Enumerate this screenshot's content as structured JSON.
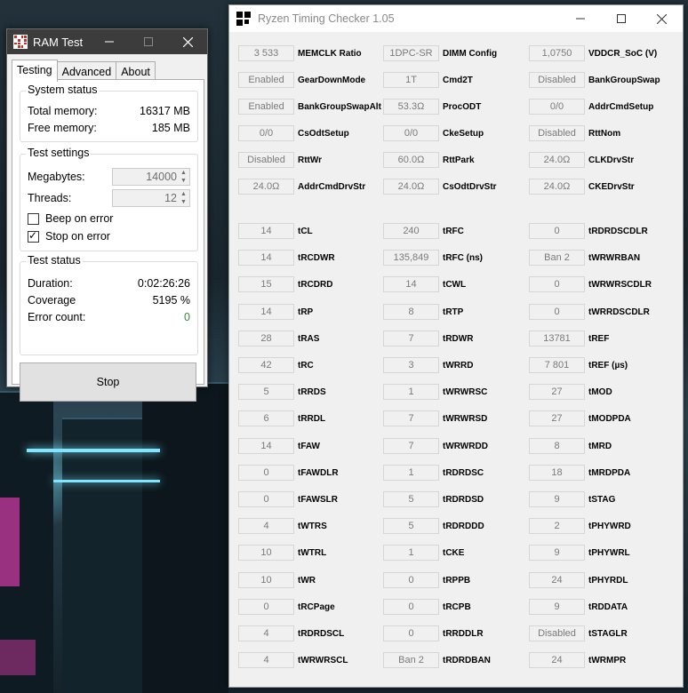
{
  "ram_test": {
    "title": "RAM Test",
    "tabs": [
      "Testing",
      "Advanced",
      "About"
    ],
    "system_status": {
      "heading": "System status",
      "total_label": "Total memory:",
      "total_value": "16317 MB",
      "free_label": "Free memory:",
      "free_value": "185 MB"
    },
    "test_settings": {
      "heading": "Test settings",
      "megabytes_label": "Megabytes:",
      "megabytes_value": "14000",
      "threads_label": "Threads:",
      "threads_value": "12",
      "beep_label": "Beep on error",
      "beep_checked": false,
      "stop_label": "Stop on error",
      "stop_checked": true
    },
    "test_status": {
      "heading": "Test status",
      "duration_label": "Duration:",
      "duration_value": "0:02:26:26",
      "coverage_label": "Coverage",
      "coverage_value": "5195 %",
      "errors_label": "Error count:",
      "errors_value": "0",
      "errors_color": "#3a8a3a"
    },
    "stop_button": "Stop"
  },
  "ryzen": {
    "title": "Ryzen Timing Checker 1.05",
    "top_cols": [
      [
        {
          "value": "3 533",
          "label": "MEMCLK Ratio"
        },
        {
          "value": "Enabled",
          "label": "GearDownMode"
        },
        {
          "value": "Enabled",
          "label": "BankGroupSwapAlt"
        },
        {
          "value": "0/0",
          "label": "CsOdtSetup"
        },
        {
          "value": "Disabled",
          "label": "RttWr"
        },
        {
          "value": "24.0Ω",
          "label": "AddrCmdDrvStr"
        }
      ],
      [
        {
          "value": "1DPC-SR",
          "label": "DIMM Config"
        },
        {
          "value": "1T",
          "label": "Cmd2T"
        },
        {
          "value": "53.3Ω",
          "label": "ProcODT"
        },
        {
          "value": "0/0",
          "label": "CkeSetup"
        },
        {
          "value": "60.0Ω",
          "label": "RttPark"
        },
        {
          "value": "24.0Ω",
          "label": "CsOdtDrvStr"
        }
      ],
      [
        {
          "value": "1,0750",
          "label": "VDDCR_SoC (V)"
        },
        {
          "value": "Disabled",
          "label": "BankGroupSwap"
        },
        {
          "value": "0/0",
          "label": "AddrCmdSetup"
        },
        {
          "value": "Disabled",
          "label": "RttNom"
        },
        {
          "value": "24.0Ω",
          "label": "CLKDrvStr"
        },
        {
          "value": "24.0Ω",
          "label": "CKEDrvStr"
        }
      ]
    ],
    "timing_cols": [
      [
        {
          "value": "14",
          "label": "tCL"
        },
        {
          "value": "14",
          "label": "tRCDWR"
        },
        {
          "value": "15",
          "label": "tRCDRD"
        },
        {
          "value": "14",
          "label": "tRP"
        },
        {
          "value": "28",
          "label": "tRAS"
        },
        {
          "value": "42",
          "label": "tRC"
        },
        {
          "value": "5",
          "label": "tRRDS"
        },
        {
          "value": "6",
          "label": "tRRDL"
        },
        {
          "value": "14",
          "label": "tFAW"
        },
        {
          "value": "0",
          "label": "tFAWDLR"
        },
        {
          "value": "0",
          "label": "tFAWSLR"
        },
        {
          "value": "4",
          "label": "tWTRS"
        },
        {
          "value": "10",
          "label": "tWTRL"
        },
        {
          "value": "10",
          "label": "tWR"
        },
        {
          "value": "0",
          "label": "tRCPage"
        },
        {
          "value": "4",
          "label": "tRDRDSCL"
        },
        {
          "value": "4",
          "label": "tWRWRSCL"
        }
      ],
      [
        {
          "value": "240",
          "label": "tRFC"
        },
        {
          "value": "135,849",
          "label": "tRFC (ns)"
        },
        {
          "value": "14",
          "label": "tCWL"
        },
        {
          "value": "8",
          "label": "tRTP"
        },
        {
          "value": "7",
          "label": "tRDWR"
        },
        {
          "value": "3",
          "label": "tWRRD"
        },
        {
          "value": "1",
          "label": "tWRWRSC"
        },
        {
          "value": "7",
          "label": "tWRWRSD"
        },
        {
          "value": "7",
          "label": "tWRWRDD"
        },
        {
          "value": "1",
          "label": "tRDRDSC"
        },
        {
          "value": "5",
          "label": "tRDRDSD"
        },
        {
          "value": "5",
          "label": "tRDRDDD"
        },
        {
          "value": "1",
          "label": "tCKE"
        },
        {
          "value": "0",
          "label": "tRPPB"
        },
        {
          "value": "0",
          "label": "tRCPB"
        },
        {
          "value": "0",
          "label": "tRRDDLR"
        },
        {
          "value": "Ban 2",
          "label": "tRDRDBAN"
        }
      ],
      [
        {
          "value": "0",
          "label": "tRDRDSCDLR"
        },
        {
          "value": "Ban 2",
          "label": "tWRWRBAN"
        },
        {
          "value": "0",
          "label": "tWRWRSCDLR"
        },
        {
          "value": "0",
          "label": "tWRRDSCDLR"
        },
        {
          "value": "13781",
          "label": "tREF"
        },
        {
          "value": "7 801",
          "label": "tREF (µs)"
        },
        {
          "value": "27",
          "label": "tMOD"
        },
        {
          "value": "27",
          "label": "tMODPDA"
        },
        {
          "value": "8",
          "label": "tMRD"
        },
        {
          "value": "18",
          "label": "tMRDPDA"
        },
        {
          "value": "9",
          "label": "tSTAG"
        },
        {
          "value": "2",
          "label": "tPHYWRD"
        },
        {
          "value": "9",
          "label": "tPHYWRL"
        },
        {
          "value": "24",
          "label": "tPHYRDL"
        },
        {
          "value": "9",
          "label": "tRDDATA"
        },
        {
          "value": "Disabled",
          "label": "tSTAGLR"
        },
        {
          "value": "24",
          "label": "tWRMPR"
        }
      ]
    ]
  }
}
